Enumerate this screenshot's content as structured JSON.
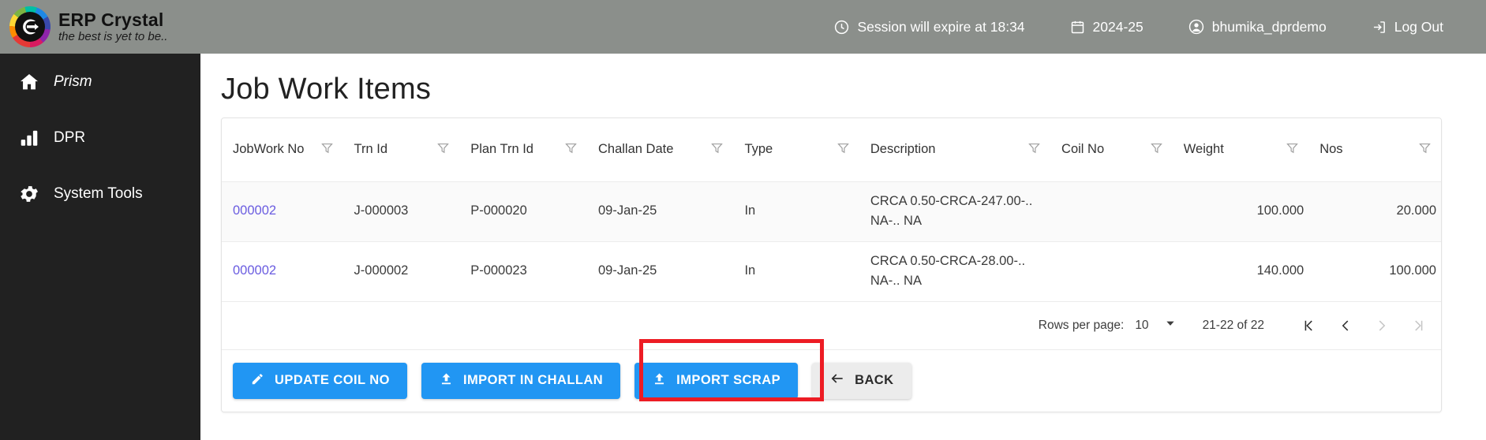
{
  "header": {
    "brand_title": "ERP Crystal",
    "brand_tagline": "the best is yet to be..",
    "logo_icon": "erp-crystal-logo",
    "session": {
      "icon": "clock-icon",
      "text": "Session will expire at 18:34"
    },
    "fiscal_year": {
      "icon": "calendar-icon",
      "text": "2024-25"
    },
    "account": {
      "icon": "account-circle-icon",
      "text": "bhumika_dprdemo"
    },
    "logout": {
      "icon": "logout-icon",
      "text": "Log Out"
    },
    "bg_color": "#8b8f8b"
  },
  "sidebar": {
    "bg_color": "#212121",
    "items": [
      {
        "label": "Prism",
        "icon": "home-icon",
        "italic": true
      },
      {
        "label": "DPR",
        "icon": "bar-chart-icon",
        "italic": false
      },
      {
        "label": "System Tools",
        "icon": "gear-icon",
        "italic": false
      }
    ]
  },
  "main": {
    "page_title": "Job Work Items",
    "table": {
      "columns": [
        {
          "label": "JobWork No",
          "filter_icon": "filter-funnel-icon",
          "align": "left"
        },
        {
          "label": "Trn Id",
          "filter_icon": "filter-funnel-icon",
          "align": "left"
        },
        {
          "label": "Plan Trn Id",
          "filter_icon": "filter-funnel-icon",
          "align": "left"
        },
        {
          "label": "Challan Date",
          "filter_icon": "filter-funnel-icon",
          "align": "left"
        },
        {
          "label": "Type",
          "filter_icon": "filter-funnel-icon",
          "align": "left"
        },
        {
          "label": "Description",
          "filter_icon": "filter-funnel-icon",
          "align": "left"
        },
        {
          "label": "Coil No",
          "filter_icon": "filter-funnel-icon",
          "align": "left"
        },
        {
          "label": "Weight",
          "filter_icon": "filter-funnel-icon",
          "align": "right"
        },
        {
          "label": "Nos",
          "filter_icon": "filter-funnel-icon",
          "align": "right"
        }
      ],
      "rows": [
        {
          "jobwork_no": "000002",
          "trn_id": "J-000003",
          "plan_trn_id": "P-000020",
          "challan_date": "09-Jan-25",
          "type": "In",
          "description": "CRCA 0.50-CRCA-247.00-.. NA-.. NA",
          "coil_no": "",
          "weight": "100.000",
          "nos": "20.000"
        },
        {
          "jobwork_no": "000002",
          "trn_id": "J-000002",
          "plan_trn_id": "P-000023",
          "challan_date": "09-Jan-25",
          "type": "In",
          "description": "CRCA 0.50-CRCA-28.00-.. NA-.. NA",
          "coil_no": "",
          "weight": "140.000",
          "nos": "100.000"
        }
      ],
      "link_color": "#6a5ce0"
    },
    "paginator": {
      "rows_per_page_label": "Rows per page:",
      "rows_per_page_value": "10",
      "dropdown_icon": "chevron-down-icon",
      "range_label": "21-22 of 22",
      "first_page_icon": "first-page-icon",
      "prev_page_icon": "chevron-left-icon",
      "next_page_icon": "chevron-right-icon",
      "last_page_icon": "last-page-icon",
      "first_page_enabled": true,
      "prev_page_enabled": true,
      "next_page_enabled": false,
      "last_page_enabled": false
    },
    "actions": [
      {
        "label": "UPDATE COIL NO",
        "icon": "pencil-icon",
        "style": "primary"
      },
      {
        "label": "IMPORT IN CHALLAN",
        "icon": "upload-icon",
        "style": "primary"
      },
      {
        "label": "IMPORT SCRAP",
        "icon": "upload-icon",
        "style": "primary"
      },
      {
        "label": "BACK",
        "icon": "arrow-left-icon",
        "style": "plain"
      }
    ],
    "primary_button_color": "#2196f3"
  },
  "annotation": {
    "color": "#ed1c24",
    "target": "IMPORT SCRAP"
  }
}
